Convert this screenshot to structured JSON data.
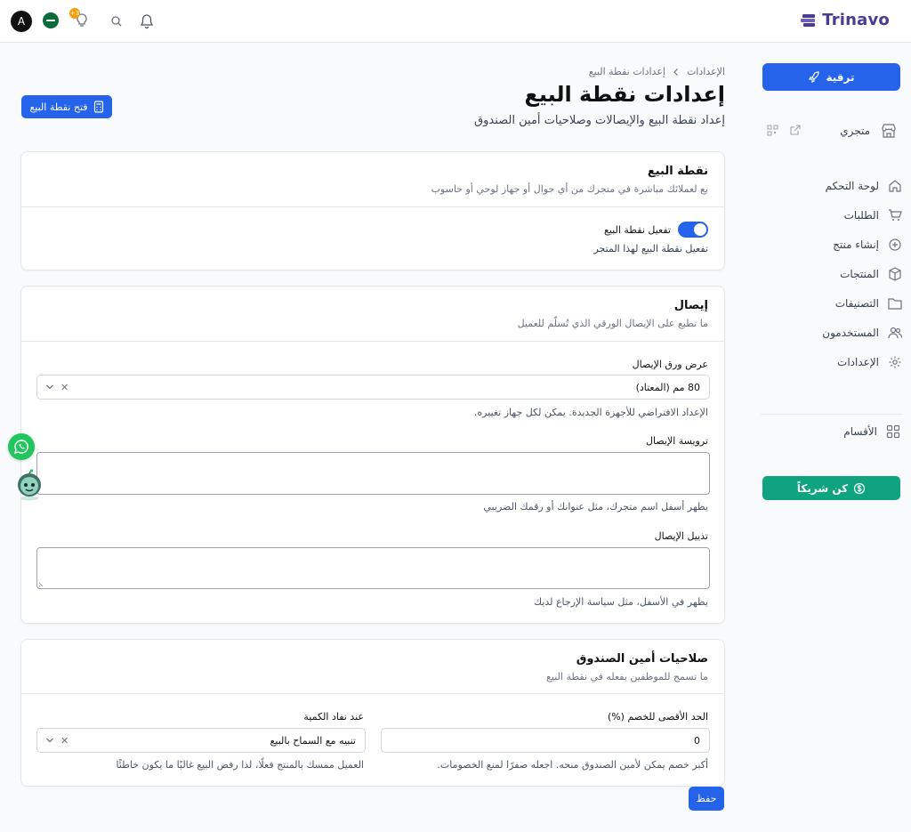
{
  "header": {
    "brand": "Trinavo",
    "avatar_letter": "A",
    "notif_badge": "+3"
  },
  "sidebar": {
    "upgrade_label": "ترقية",
    "store_label": "متجري",
    "items": [
      {
        "label": "لوحة التحكم",
        "icon": "home-icon"
      },
      {
        "label": "الطلبات",
        "icon": "cart-icon"
      },
      {
        "label": "إنشاء منتج",
        "icon": "plus-circle-icon"
      },
      {
        "label": "المنتجات",
        "icon": "box-icon"
      },
      {
        "label": "التصنيفات",
        "icon": "folder-icon"
      },
      {
        "label": "المستخدمون",
        "icon": "users-icon"
      },
      {
        "label": "الإعدادات",
        "icon": "gear-icon"
      }
    ],
    "sections_label": "الأقسام",
    "partner_label": "كن شريكاً"
  },
  "page": {
    "breadcrumb_root": "الإعدادات",
    "breadcrumb_current": "إعدادات نقطة البيع",
    "title": "إعدادات نقطة البيع",
    "subtitle": "إعداد نقطة البيع والإيصالات وصلاحيات أمين الصندوق",
    "open_pos_label": "فتح نقطة البيع"
  },
  "pos_card": {
    "title": "نقطة البيع",
    "desc": "بع لعملائك مباشرة في متجرك من أي جوال أو جهاز لوحي أو حاسوب",
    "toggle_label": "تفعيل نقطة البيع",
    "toggle_on": true,
    "toggle_help": "تفعيل نقطة البيع لهذا المتجر"
  },
  "receipt_card": {
    "title": "إيصال",
    "desc": "ما تطبع على الإيصال الورقي الذي تُسلّم للعميل",
    "paper_label": "عرض ورق الإيصال",
    "paper_value": "80 مم (المعتاد)",
    "paper_help": "الإعداد الافتراضي للأجهزة الجديدة. يمكن لكل جهاز تغييره.",
    "header_label": "ترويسة الإيصال",
    "header_help": "يظهر أسفل اسم متجرك، مثل عنوانك أو رقمك الضريبي",
    "footer_label": "تذييل الإيصال",
    "footer_help": "يظهر في الأسفل، مثل سياسة الإرجاع لديك"
  },
  "cashier_card": {
    "title": "صلاحيات أمين الصندوق",
    "desc": "ما تسمح للموظفين بفعله في نقطة البيع",
    "discount_label": "الحد الأقصى للخصم (%)",
    "discount_value": "0",
    "discount_help": "أكبر خصم يمكن لأمين الصندوق منحه. اجعله صفرًا لمنع الخصومات.",
    "stock_label": "عند نفاد الكمية",
    "stock_value": "تنبيه مع السماح بالبيع",
    "stock_help": "العميل ممسك بالمنتج فعلًا، لذا رفض البيع غالبًا ما يكون خاطئًا"
  },
  "actions": {
    "save_label": "حفظ"
  },
  "colors": {
    "primary": "#2563eb",
    "partner": "#10a37f",
    "brand": "#4a3d8f",
    "whatsapp": "#22c55e"
  }
}
